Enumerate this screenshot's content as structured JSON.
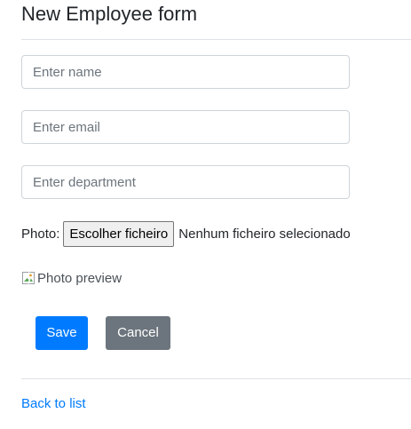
{
  "page": {
    "title": "New Employee form"
  },
  "form": {
    "name": {
      "placeholder": "Enter name",
      "value": ""
    },
    "email": {
      "placeholder": "Enter email",
      "value": ""
    },
    "department": {
      "placeholder": "Enter department",
      "value": ""
    },
    "photo": {
      "label": "Photo:",
      "button_label": "Escolher ficheiro",
      "status": "Nenhum ficheiro selecionado"
    },
    "preview": {
      "alt": "Photo preview",
      "icon": "broken-image-icon"
    },
    "save_label": "Save",
    "cancel_label": "Cancel"
  },
  "footer": {
    "back_link": "Back to list"
  },
  "colors": {
    "primary": "#007bff",
    "secondary": "#6c757d",
    "border": "#ced4da",
    "divider": "#dee2e6"
  }
}
